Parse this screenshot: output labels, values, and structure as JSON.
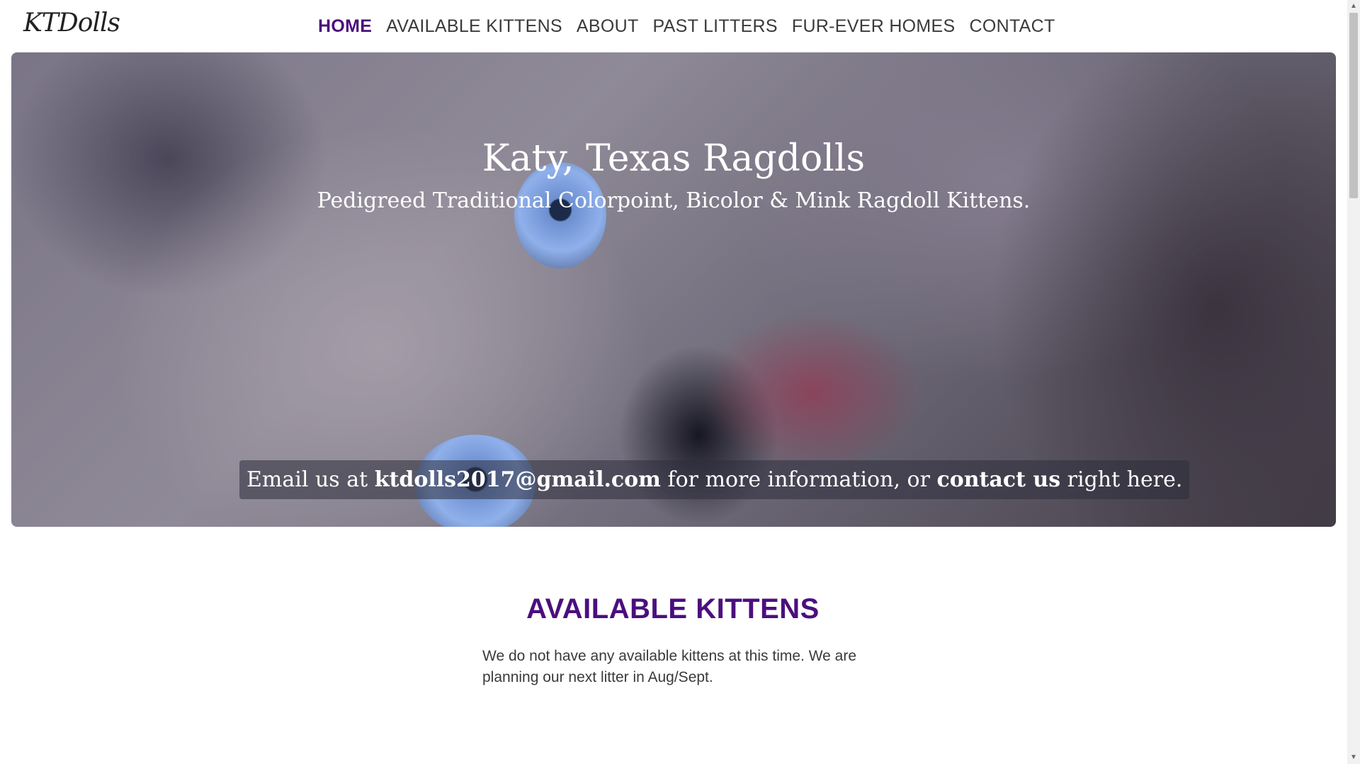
{
  "header": {
    "logo": "KTDolls",
    "nav": [
      {
        "label": "HOME",
        "active": true
      },
      {
        "label": "AVAILABLE KITTENS",
        "active": false
      },
      {
        "label": "ABOUT",
        "active": false
      },
      {
        "label": "PAST LITTERS",
        "active": false
      },
      {
        "label": "FUR-EVER HOMES",
        "active": false
      },
      {
        "label": "CONTACT",
        "active": false
      }
    ]
  },
  "hero": {
    "title": "Katy, Texas Ragdolls",
    "subtitle": "Pedigreed Traditional Colorpoint, Bicolor & Mink Ragdoll Kittens.",
    "email_prefix": "Email us at ",
    "email": "ktdolls2017@gmail.com",
    "email_middle": " for more information, or ",
    "contact_link": "contact us",
    "email_suffix": " right here."
  },
  "available_kittens": {
    "heading": "AVAILABLE KITTENS",
    "body": "We do not have any available kittens at this time. We are planning our next litter in Aug/Sept."
  },
  "colors": {
    "accent": "#4b0f7d",
    "text": "#3a3a3a"
  }
}
